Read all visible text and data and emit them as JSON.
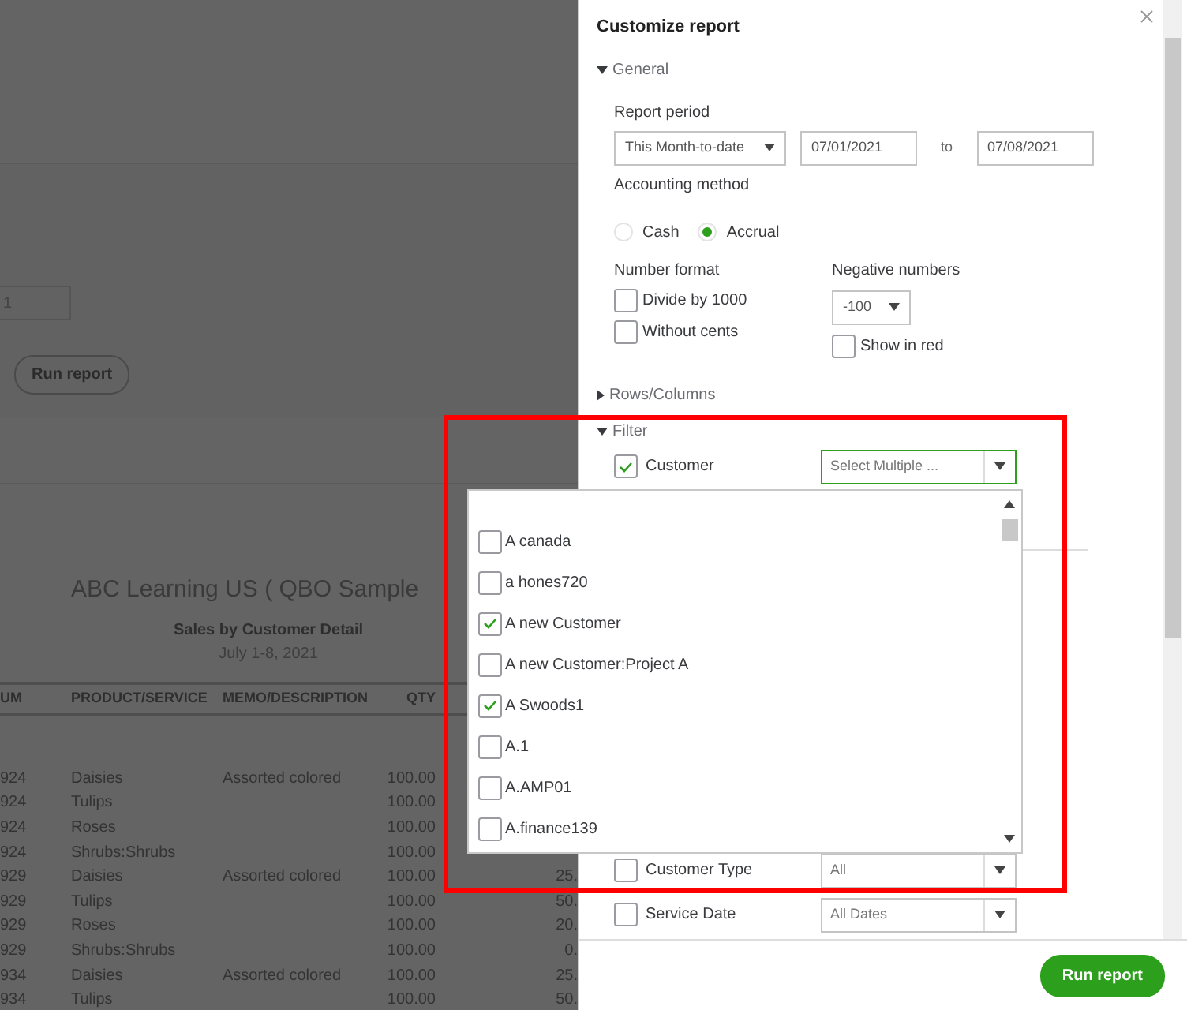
{
  "report_page": {
    "date_field": "1",
    "run_button": "Run report",
    "company": "ABC Learning US ( QBO Sample",
    "report_title": "Sales by Customer Detail",
    "date_range": "July 1-8, 2021",
    "table": {
      "columns": [
        "UM",
        "PRODUCT/SERVICE",
        "MEMO/DESCRIPTION",
        "QTY"
      ],
      "rows": [
        {
          "cells": [
            "924",
            "Daisies",
            "Assorted colored",
            "100.00"
          ]
        },
        {
          "cells": [
            "924",
            "Tulips",
            "",
            "100.00"
          ]
        },
        {
          "cells": [
            "924",
            "Roses",
            "",
            "100.00"
          ]
        },
        {
          "cells": [
            "924",
            "Shrubs:Shrubs",
            "",
            "100.00"
          ]
        },
        {
          "cells": [
            "929",
            "Daisies",
            "Assorted colored",
            "100.00",
            "25."
          ]
        },
        {
          "cells": [
            "929",
            "Tulips",
            "",
            "100.00",
            "50."
          ]
        },
        {
          "cells": [
            "929",
            "Roses",
            "",
            "100.00",
            "20."
          ]
        },
        {
          "cells": [
            "929",
            "Shrubs:Shrubs",
            "",
            "100.00",
            "0."
          ]
        },
        {
          "cells": [
            "934",
            "Daisies",
            "Assorted colored",
            "100.00",
            "25."
          ]
        },
        {
          "cells": [
            "934",
            "Tulips",
            "",
            "100.00",
            "50."
          ]
        }
      ]
    }
  },
  "panel": {
    "title": "Customize report",
    "general": {
      "label": "General",
      "expanded": true,
      "report_period": {
        "label": "Report period",
        "value": "This Month-to-date",
        "from": "07/01/2021",
        "to_label": "to",
        "to": "07/08/2021"
      },
      "accounting_method": {
        "label": "Accounting method",
        "options": [
          {
            "label": "Cash",
            "selected": false
          },
          {
            "label": "Accrual",
            "selected": true
          }
        ]
      },
      "number_format": {
        "label": "Number format",
        "options": [
          {
            "label": "Divide by 1000",
            "checked": false
          },
          {
            "label": "Without cents",
            "checked": false
          }
        ]
      },
      "negative_numbers": {
        "label": "Negative numbers",
        "value": "-100",
        "show_in_red": {
          "label": "Show in red",
          "checked": false
        }
      }
    },
    "rows_columns": {
      "label": "Rows/Columns",
      "expanded": false
    },
    "filter": {
      "label": "Filter",
      "expanded": true,
      "items": [
        {
          "label": "Customer",
          "checked": true,
          "value": "Select Multiple ...",
          "focused": true
        },
        {
          "label": "Customer Type",
          "checked": false,
          "value": "All",
          "focused": false
        },
        {
          "label": "Service Date",
          "checked": false,
          "value": "All Dates",
          "focused": false
        }
      ]
    },
    "run_button": "Run report"
  },
  "customer_dropdown": {
    "options": [
      {
        "label": "A canada",
        "checked": false
      },
      {
        "label": "a hones720",
        "checked": false
      },
      {
        "label": "A new Customer",
        "checked": true
      },
      {
        "label": "A new Customer:Project A",
        "checked": false
      },
      {
        "label": "A Swoods1",
        "checked": true
      },
      {
        "label": "A.1",
        "checked": false
      },
      {
        "label": "A.AMP01",
        "checked": false
      },
      {
        "label": "A.finance139",
        "checked": false
      }
    ]
  }
}
